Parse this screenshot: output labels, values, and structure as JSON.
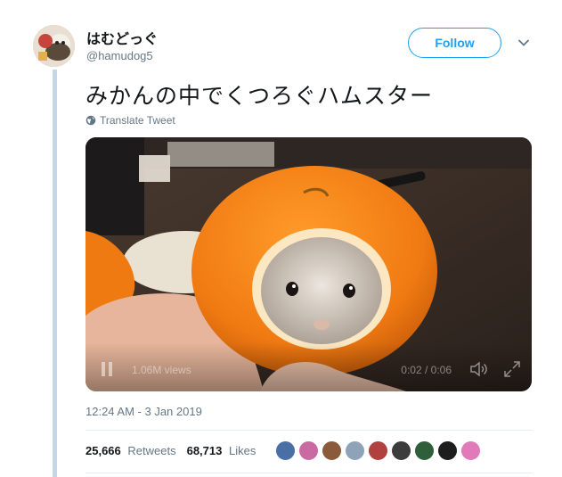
{
  "user": {
    "display_name": "はむどっぐ",
    "screen_name": "@hamudog5"
  },
  "follow_label": "Follow",
  "tweet_text": "みかんの中でくつろぐハムスター",
  "translate_label": "Translate Tweet",
  "video": {
    "views": "1.06M views",
    "time": "0:02 / 0:06"
  },
  "timestamp": "12:24 AM - 3 Jan 2019",
  "stats": {
    "retweets_count": "25,666",
    "retweets_label": "Retweets",
    "likes_count": "68,713",
    "likes_label": "Likes"
  },
  "likers": [
    {
      "color": "#4a6fa5"
    },
    {
      "color": "#c96aa3"
    },
    {
      "color": "#8a5a3a"
    },
    {
      "color": "#8fa3b8"
    },
    {
      "color": "#b0413e"
    },
    {
      "color": "#3c3c3c"
    },
    {
      "color": "#2f5e3a"
    },
    {
      "color": "#1d1d1d"
    },
    {
      "color": "#e07ab8"
    }
  ],
  "colors": {
    "accent": "#1da1f2",
    "thread_line": "#c4d7e4",
    "secondary_text": "#657786"
  }
}
